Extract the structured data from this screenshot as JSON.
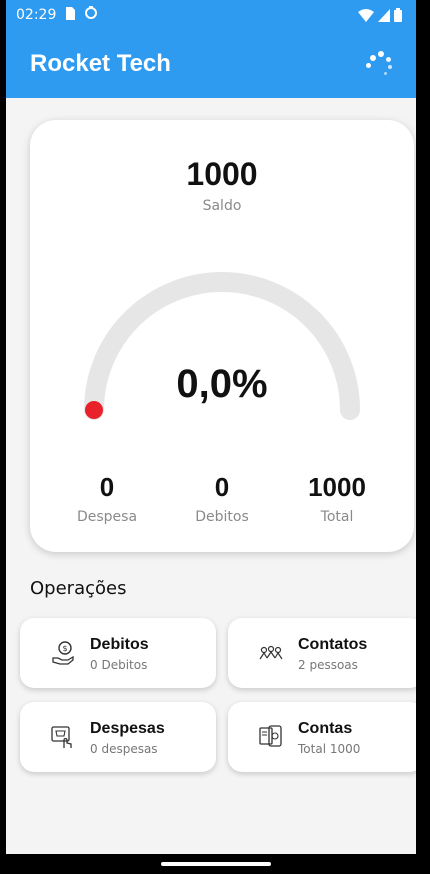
{
  "status": {
    "time": "02:29"
  },
  "app": {
    "title": "Rocket Tech"
  },
  "balance": {
    "value": "1000",
    "label": "Saldo"
  },
  "gauge": {
    "percent_text": "0,0%",
    "fraction": 0.0
  },
  "stats": [
    {
      "value": "0",
      "label": "Despesa"
    },
    {
      "value": "0",
      "label": "Debitos"
    },
    {
      "value": "1000",
      "label": "Total"
    }
  ],
  "operations": {
    "title": "Operações",
    "items": [
      {
        "title": "Debitos",
        "subtitle": "0 Debitos",
        "icon": "money-hand-icon"
      },
      {
        "title": "Contatos",
        "subtitle": "2 pessoas",
        "icon": "people-icon"
      },
      {
        "title": "Despesas",
        "subtitle": "0 despesas",
        "icon": "cart-icon"
      },
      {
        "title": "Contas",
        "subtitle": "Total 1000",
        "icon": "bill-icon"
      }
    ]
  },
  "colors": {
    "primary": "#2f9bf0",
    "gauge_track": "#e6e6e6",
    "gauge_marker": "#e8212b"
  }
}
